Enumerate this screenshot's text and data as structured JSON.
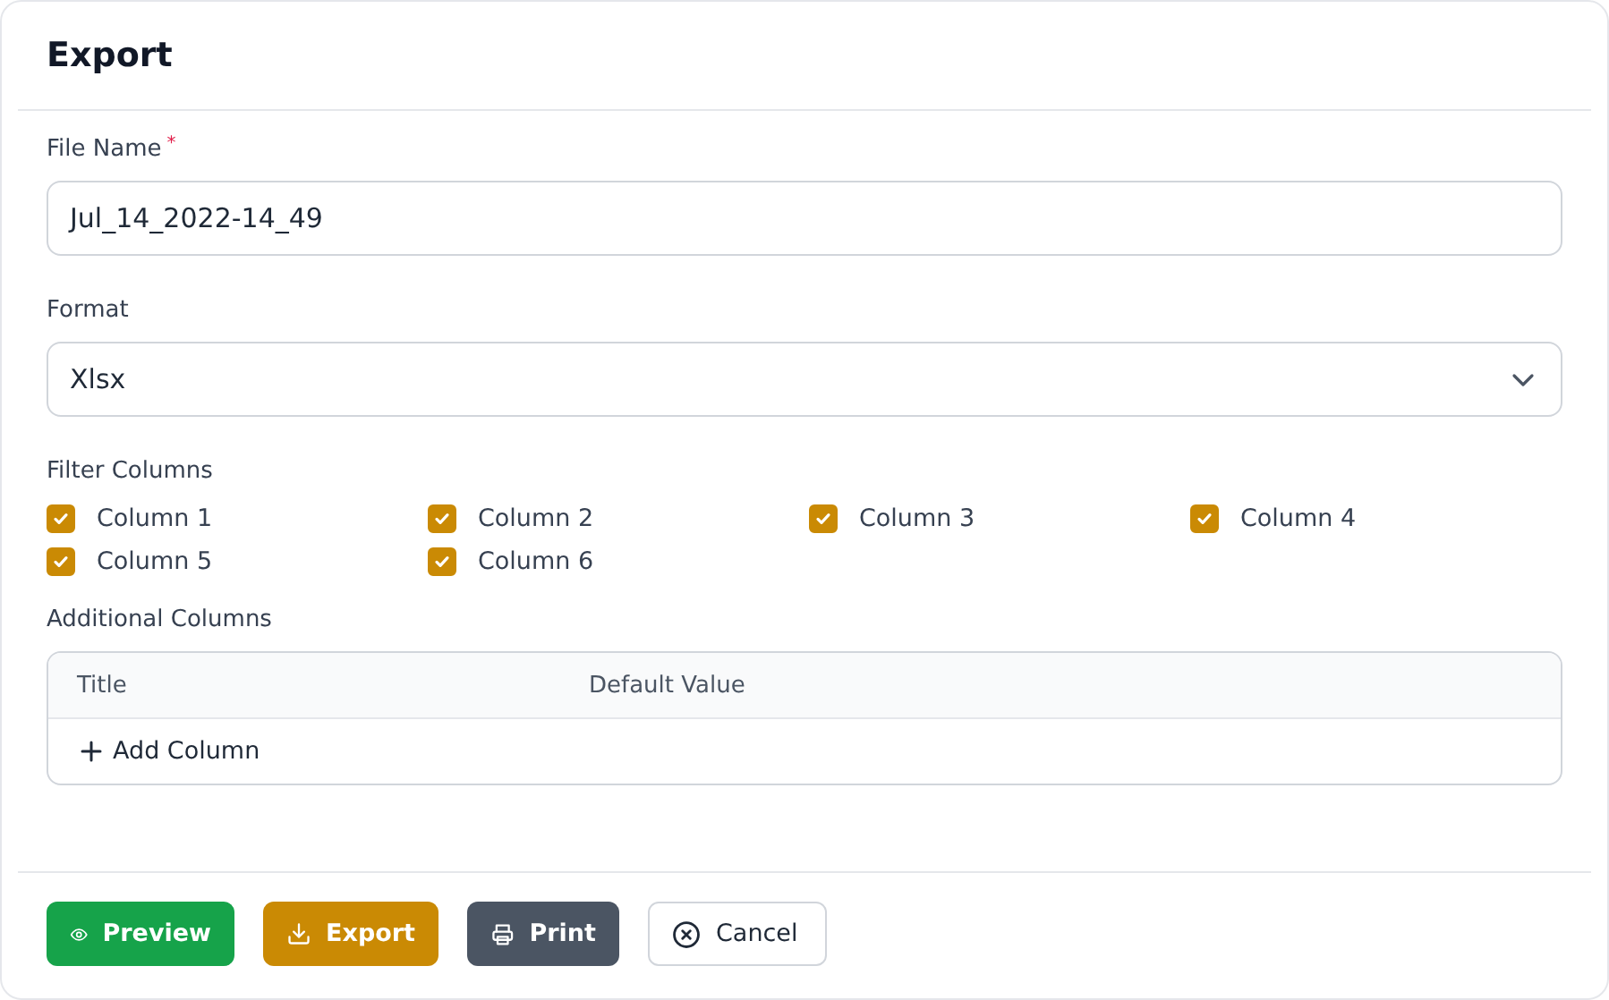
{
  "dialog": {
    "title": "Export"
  },
  "file_name": {
    "label": "File Name",
    "required_mark": "*",
    "value": "Jul_14_2022-14_49"
  },
  "format": {
    "label": "Format",
    "value": "Xlsx"
  },
  "filter_columns": {
    "label": "Filter Columns",
    "items": [
      {
        "label": "Column 1",
        "checked": true
      },
      {
        "label": "Column 2",
        "checked": true
      },
      {
        "label": "Column 3",
        "checked": true
      },
      {
        "label": "Column 4",
        "checked": true
      },
      {
        "label": "Column 5",
        "checked": true
      },
      {
        "label": "Column 6",
        "checked": true
      }
    ]
  },
  "additional_columns": {
    "label": "Additional Columns",
    "columns": [
      "Title",
      "Default Value"
    ],
    "add_label": "Add Column"
  },
  "buttons": [
    {
      "label": "Preview",
      "kind": "preview"
    },
    {
      "label": "Export",
      "kind": "export"
    },
    {
      "label": "Print",
      "kind": "print"
    },
    {
      "label": "Cancel",
      "kind": "cancel"
    }
  ]
}
